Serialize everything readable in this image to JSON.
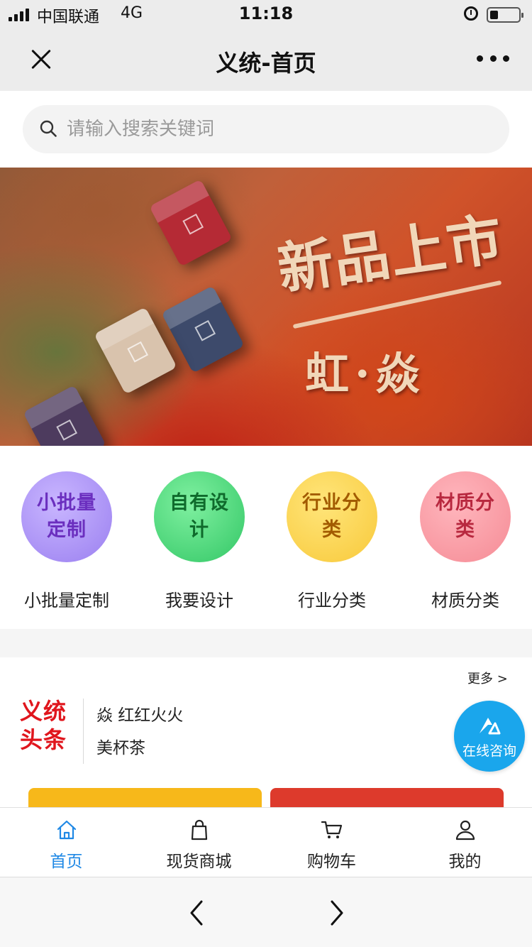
{
  "status_bar": {
    "carrier": "中国联通",
    "network": "4G",
    "time": "11:18",
    "battery_level": 0.3
  },
  "nav": {
    "title": "义统-首页",
    "close_icon": "close-icon",
    "more_icon": "more-dots-icon"
  },
  "search": {
    "placeholder": "请输入搜索关键词",
    "value": "",
    "icon": "search-icon"
  },
  "banner": {
    "headline": "新品上市",
    "subline": "虹·焱"
  },
  "categories": [
    {
      "circle_text": "小批量定制",
      "label": "小批量定制",
      "color": "#9a7ff0"
    },
    {
      "circle_text": "自有设计",
      "label": "我要设计",
      "color": "#33c766"
    },
    {
      "circle_text": "行业分类",
      "label": "行业分类",
      "color": "#f8c93a"
    },
    {
      "circle_text": "材质分类",
      "label": "材质分类",
      "color": "#f58b95"
    }
  ],
  "news": {
    "logo": "义统头条",
    "more": "更多 >",
    "items": [
      "焱 红红火火",
      "美杯茶"
    ]
  },
  "consult": {
    "label": "在线咨询",
    "color": "#1aa6ec"
  },
  "tabs": [
    {
      "label": "首页",
      "icon": "home-icon",
      "active": true
    },
    {
      "label": "现货商城",
      "icon": "shopping-bag-icon",
      "active": false
    },
    {
      "label": "购物车",
      "icon": "cart-icon",
      "active": false
    },
    {
      "label": "我的",
      "icon": "user-icon",
      "active": false
    }
  ],
  "colors": {
    "accent": "#1f88e5",
    "brand_red": "#e0161d"
  }
}
